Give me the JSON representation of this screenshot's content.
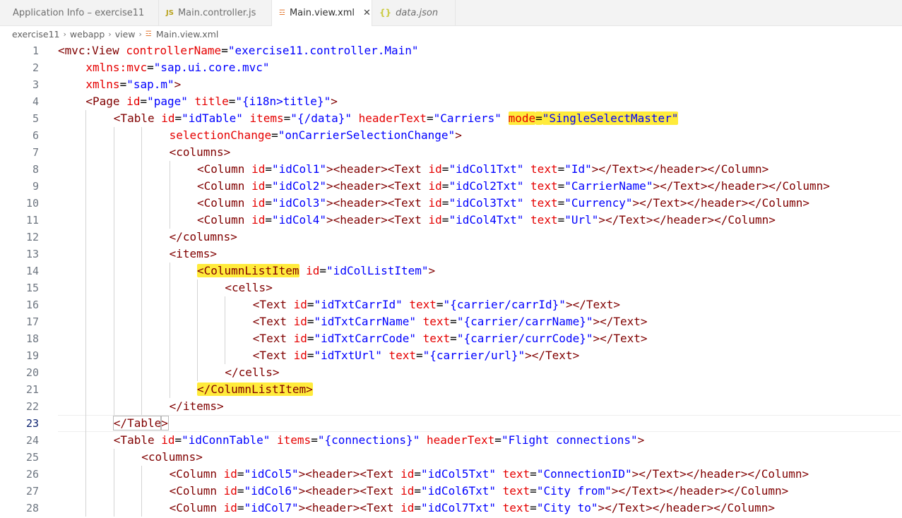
{
  "tabs": [
    {
      "label": "Application Info – exercise11",
      "icon": "info-icon",
      "active": false
    },
    {
      "label": "Main.controller.js",
      "icon": "js-file-icon",
      "active": false
    },
    {
      "label": "Main.view.xml",
      "icon": "rss-xml-icon",
      "active": true
    },
    {
      "label": "data.json",
      "icon": "json-braces-icon",
      "active": false
    }
  ],
  "close_glyph": "✕",
  "breadcrumb": [
    "exercise11",
    "webapp",
    "view",
    "Main.view.xml"
  ],
  "highlight_color": "#ffeb3b",
  "colors": {
    "tag": "#800000",
    "attribute": "#e50000",
    "string": "#0000ff"
  },
  "current_line": 23,
  "editor": {
    "lines": [
      {
        "n": 1,
        "indent": 0,
        "code": [
          [
            "tg",
            "<mvc:View "
          ],
          [
            "at",
            "controllerName"
          ],
          [
            "pu",
            "="
          ],
          [
            "st",
            "\"exercise11.controller.Main\""
          ]
        ]
      },
      {
        "n": 2,
        "indent": 1,
        "code": [
          [
            "at",
            "xmlns:mvc"
          ],
          [
            "pu",
            "="
          ],
          [
            "st",
            "\"sap.ui.core.mvc\""
          ]
        ]
      },
      {
        "n": 3,
        "indent": 1,
        "code": [
          [
            "at",
            "xmlns"
          ],
          [
            "pu",
            "="
          ],
          [
            "st",
            "\"sap.m\""
          ],
          [
            "tg",
            ">"
          ]
        ]
      },
      {
        "n": 4,
        "indent": 1,
        "code": [
          [
            "tg",
            "<Page "
          ],
          [
            "at",
            "id"
          ],
          [
            "pu",
            "="
          ],
          [
            "st",
            "\"page\""
          ],
          [
            "pu",
            " "
          ],
          [
            "at",
            "title"
          ],
          [
            "pu",
            "="
          ],
          [
            "st",
            "\"{i18n>title}\""
          ],
          [
            "tg",
            ">"
          ]
        ]
      },
      {
        "n": 5,
        "indent": 2,
        "code": [
          [
            "tg",
            "<Table "
          ],
          [
            "at",
            "id"
          ],
          [
            "pu",
            "="
          ],
          [
            "st",
            "\"idTable\""
          ],
          [
            "pu",
            " "
          ],
          [
            "at",
            "items"
          ],
          [
            "pu",
            "="
          ],
          [
            "st",
            "\"{/data}\""
          ],
          [
            "pu",
            " "
          ],
          [
            "at",
            "headerText"
          ],
          [
            "pu",
            "="
          ],
          [
            "st",
            "\"Carriers\""
          ],
          [
            "pu",
            " "
          ],
          [
            "at",
            "mode",
            "hl"
          ],
          [
            "pu",
            "=",
            "hl"
          ],
          [
            "st",
            "\"SingleSelectMaster\"",
            "hl"
          ]
        ]
      },
      {
        "n": 6,
        "indent": 4,
        "code": [
          [
            "at",
            "selectionChange"
          ],
          [
            "pu",
            "="
          ],
          [
            "st",
            "\"onCarrierSelectionChange\""
          ],
          [
            "tg",
            ">"
          ]
        ]
      },
      {
        "n": 7,
        "indent": 4,
        "code": [
          [
            "tg",
            "<columns>"
          ]
        ]
      },
      {
        "n": 8,
        "indent": 5,
        "code": [
          [
            "tg",
            "<Column "
          ],
          [
            "at",
            "id"
          ],
          [
            "pu",
            "="
          ],
          [
            "st",
            "\"idCol1\""
          ],
          [
            "tg",
            "><header><Text "
          ],
          [
            "at",
            "id"
          ],
          [
            "pu",
            "="
          ],
          [
            "st",
            "\"idCol1Txt\""
          ],
          [
            "pu",
            " "
          ],
          [
            "at",
            "text"
          ],
          [
            "pu",
            "="
          ],
          [
            "st",
            "\"Id\""
          ],
          [
            "tg",
            "></Text></header></Column>"
          ]
        ]
      },
      {
        "n": 9,
        "indent": 5,
        "code": [
          [
            "tg",
            "<Column "
          ],
          [
            "at",
            "id"
          ],
          [
            "pu",
            "="
          ],
          [
            "st",
            "\"idCol2\""
          ],
          [
            "tg",
            "><header><Text "
          ],
          [
            "at",
            "id"
          ],
          [
            "pu",
            "="
          ],
          [
            "st",
            "\"idCol2Txt\""
          ],
          [
            "pu",
            " "
          ],
          [
            "at",
            "text"
          ],
          [
            "pu",
            "="
          ],
          [
            "st",
            "\"CarrierName\""
          ],
          [
            "tg",
            "></Text></header></Column>"
          ]
        ]
      },
      {
        "n": 10,
        "indent": 5,
        "code": [
          [
            "tg",
            "<Column "
          ],
          [
            "at",
            "id"
          ],
          [
            "pu",
            "="
          ],
          [
            "st",
            "\"idCol3\""
          ],
          [
            "tg",
            "><header><Text "
          ],
          [
            "at",
            "id"
          ],
          [
            "pu",
            "="
          ],
          [
            "st",
            "\"idCol3Txt\""
          ],
          [
            "pu",
            " "
          ],
          [
            "at",
            "text"
          ],
          [
            "pu",
            "="
          ],
          [
            "st",
            "\"Currency\""
          ],
          [
            "tg",
            "></Text></header></Column>"
          ]
        ]
      },
      {
        "n": 11,
        "indent": 5,
        "code": [
          [
            "tg",
            "<Column "
          ],
          [
            "at",
            "id"
          ],
          [
            "pu",
            "="
          ],
          [
            "st",
            "\"idCol4\""
          ],
          [
            "tg",
            "><header><Text "
          ],
          [
            "at",
            "id"
          ],
          [
            "pu",
            "="
          ],
          [
            "st",
            "\"idCol4Txt\""
          ],
          [
            "pu",
            " "
          ],
          [
            "at",
            "text"
          ],
          [
            "pu",
            "="
          ],
          [
            "st",
            "\"Url\""
          ],
          [
            "tg",
            "></Text></header></Column>"
          ]
        ]
      },
      {
        "n": 12,
        "indent": 4,
        "code": [
          [
            "tg",
            "</columns>"
          ]
        ]
      },
      {
        "n": 13,
        "indent": 4,
        "code": [
          [
            "tg",
            "<items>"
          ]
        ]
      },
      {
        "n": 14,
        "indent": 5,
        "code": [
          [
            "tg",
            "<ColumnListItem",
            "hl"
          ],
          [
            "tg",
            " "
          ],
          [
            "at",
            "id"
          ],
          [
            "pu",
            "="
          ],
          [
            "st",
            "\"idColListItem\""
          ],
          [
            "tg",
            ">"
          ]
        ]
      },
      {
        "n": 15,
        "indent": 6,
        "code": [
          [
            "tg",
            "<cells>"
          ]
        ]
      },
      {
        "n": 16,
        "indent": 7,
        "code": [
          [
            "tg",
            "<Text "
          ],
          [
            "at",
            "id"
          ],
          [
            "pu",
            "="
          ],
          [
            "st",
            "\"idTxtCarrId\""
          ],
          [
            "pu",
            " "
          ],
          [
            "at",
            "text"
          ],
          [
            "pu",
            "="
          ],
          [
            "st",
            "\"{carrier/carrId}\""
          ],
          [
            "tg",
            "></Text>"
          ]
        ]
      },
      {
        "n": 17,
        "indent": 7,
        "code": [
          [
            "tg",
            "<Text "
          ],
          [
            "at",
            "id"
          ],
          [
            "pu",
            "="
          ],
          [
            "st",
            "\"idTxtCarrName\""
          ],
          [
            "pu",
            " "
          ],
          [
            "at",
            "text"
          ],
          [
            "pu",
            "="
          ],
          [
            "st",
            "\"{carrier/carrName}\""
          ],
          [
            "tg",
            "></Text>"
          ]
        ]
      },
      {
        "n": 18,
        "indent": 7,
        "code": [
          [
            "tg",
            "<Text "
          ],
          [
            "at",
            "id"
          ],
          [
            "pu",
            "="
          ],
          [
            "st",
            "\"idTxtCarrCode\""
          ],
          [
            "pu",
            " "
          ],
          [
            "at",
            "text"
          ],
          [
            "pu",
            "="
          ],
          [
            "st",
            "\"{carrier/currCode}\""
          ],
          [
            "tg",
            "></Text>"
          ]
        ]
      },
      {
        "n": 19,
        "indent": 7,
        "code": [
          [
            "tg",
            "<Text "
          ],
          [
            "at",
            "id"
          ],
          [
            "pu",
            "="
          ],
          [
            "st",
            "\"idTxtUrl\""
          ],
          [
            "pu",
            " "
          ],
          [
            "at",
            "text"
          ],
          [
            "pu",
            "="
          ],
          [
            "st",
            "\"{carrier/url}\""
          ],
          [
            "tg",
            "></Text>"
          ]
        ]
      },
      {
        "n": 20,
        "indent": 6,
        "code": [
          [
            "tg",
            "</cells>"
          ]
        ]
      },
      {
        "n": 21,
        "indent": 5,
        "code": [
          [
            "tg",
            "</ColumnListItem>",
            "hl"
          ]
        ]
      },
      {
        "n": 22,
        "indent": 4,
        "code": [
          [
            "tg",
            "</items>"
          ]
        ]
      },
      {
        "n": 23,
        "indent": 2,
        "code": [
          [
            "tg",
            "</Table",
            "bm"
          ],
          [
            "tg",
            ">",
            "bm"
          ]
        ]
      },
      {
        "n": 24,
        "indent": 2,
        "code": [
          [
            "tg",
            "<Table "
          ],
          [
            "at",
            "id"
          ],
          [
            "pu",
            "="
          ],
          [
            "st",
            "\"idConnTable\""
          ],
          [
            "pu",
            " "
          ],
          [
            "at",
            "items"
          ],
          [
            "pu",
            "="
          ],
          [
            "st",
            "\"{connections}\""
          ],
          [
            "pu",
            " "
          ],
          [
            "at",
            "headerText"
          ],
          [
            "pu",
            "="
          ],
          [
            "st",
            "\"Flight connections\""
          ],
          [
            "tg",
            ">"
          ]
        ]
      },
      {
        "n": 25,
        "indent": 3,
        "code": [
          [
            "tg",
            "<columns>"
          ]
        ]
      },
      {
        "n": 26,
        "indent": 4,
        "code": [
          [
            "tg",
            "<Column "
          ],
          [
            "at",
            "id"
          ],
          [
            "pu",
            "="
          ],
          [
            "st",
            "\"idCol5\""
          ],
          [
            "tg",
            "><header><Text "
          ],
          [
            "at",
            "id"
          ],
          [
            "pu",
            "="
          ],
          [
            "st",
            "\"idCol5Txt\""
          ],
          [
            "pu",
            " "
          ],
          [
            "at",
            "text"
          ],
          [
            "pu",
            "="
          ],
          [
            "st",
            "\"ConnectionID\""
          ],
          [
            "tg",
            "></Text></header></Column>"
          ]
        ]
      },
      {
        "n": 27,
        "indent": 4,
        "code": [
          [
            "tg",
            "<Column "
          ],
          [
            "at",
            "id"
          ],
          [
            "pu",
            "="
          ],
          [
            "st",
            "\"idCol6\""
          ],
          [
            "tg",
            "><header><Text "
          ],
          [
            "at",
            "id"
          ],
          [
            "pu",
            "="
          ],
          [
            "st",
            "\"idCol6Txt\""
          ],
          [
            "pu",
            " "
          ],
          [
            "at",
            "text"
          ],
          [
            "pu",
            "="
          ],
          [
            "st",
            "\"City from\""
          ],
          [
            "tg",
            "></Text></header></Column>"
          ]
        ]
      },
      {
        "n": 28,
        "indent": 4,
        "code": [
          [
            "tg",
            "<Column "
          ],
          [
            "at",
            "id"
          ],
          [
            "pu",
            "="
          ],
          [
            "st",
            "\"idCol7\""
          ],
          [
            "tg",
            "><header><Text "
          ],
          [
            "at",
            "id"
          ],
          [
            "pu",
            "="
          ],
          [
            "st",
            "\"idCol7Txt\""
          ],
          [
            "pu",
            " "
          ],
          [
            "at",
            "text"
          ],
          [
            "pu",
            "="
          ],
          [
            "st",
            "\"City to\""
          ],
          [
            "tg",
            "></Text></header></Column>"
          ]
        ]
      }
    ]
  }
}
